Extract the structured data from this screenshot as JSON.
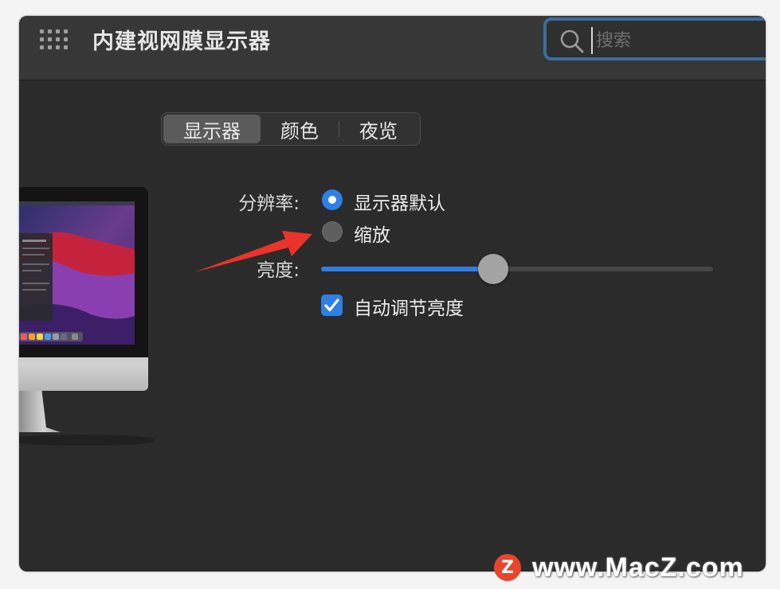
{
  "window": {
    "title": "内建视网膜显示器",
    "search_placeholder": "搜索"
  },
  "tabs": [
    {
      "label": "显示器",
      "active": true
    },
    {
      "label": "颜色",
      "active": false
    },
    {
      "label": "夜览",
      "active": false
    }
  ],
  "resolution": {
    "label": "分辨率:",
    "options": [
      {
        "label": "显示器默认",
        "selected": true
      },
      {
        "label": "缩放",
        "selected": false
      }
    ]
  },
  "brightness": {
    "label": "亮度:",
    "value_fraction": 0.44,
    "auto_adjust_label": "自动调节亮度",
    "auto_adjust_checked": true
  },
  "colors": {
    "accent": "#2f7fe6",
    "window_bg": "#2b2b2b",
    "annotation_arrow": "#e8342a"
  },
  "icons": [
    "grid-icon",
    "search-icon",
    "checkmark-icon",
    "imac-icon"
  ],
  "watermark": {
    "logo_letter": "Z",
    "text": "www.MacZ.com"
  }
}
